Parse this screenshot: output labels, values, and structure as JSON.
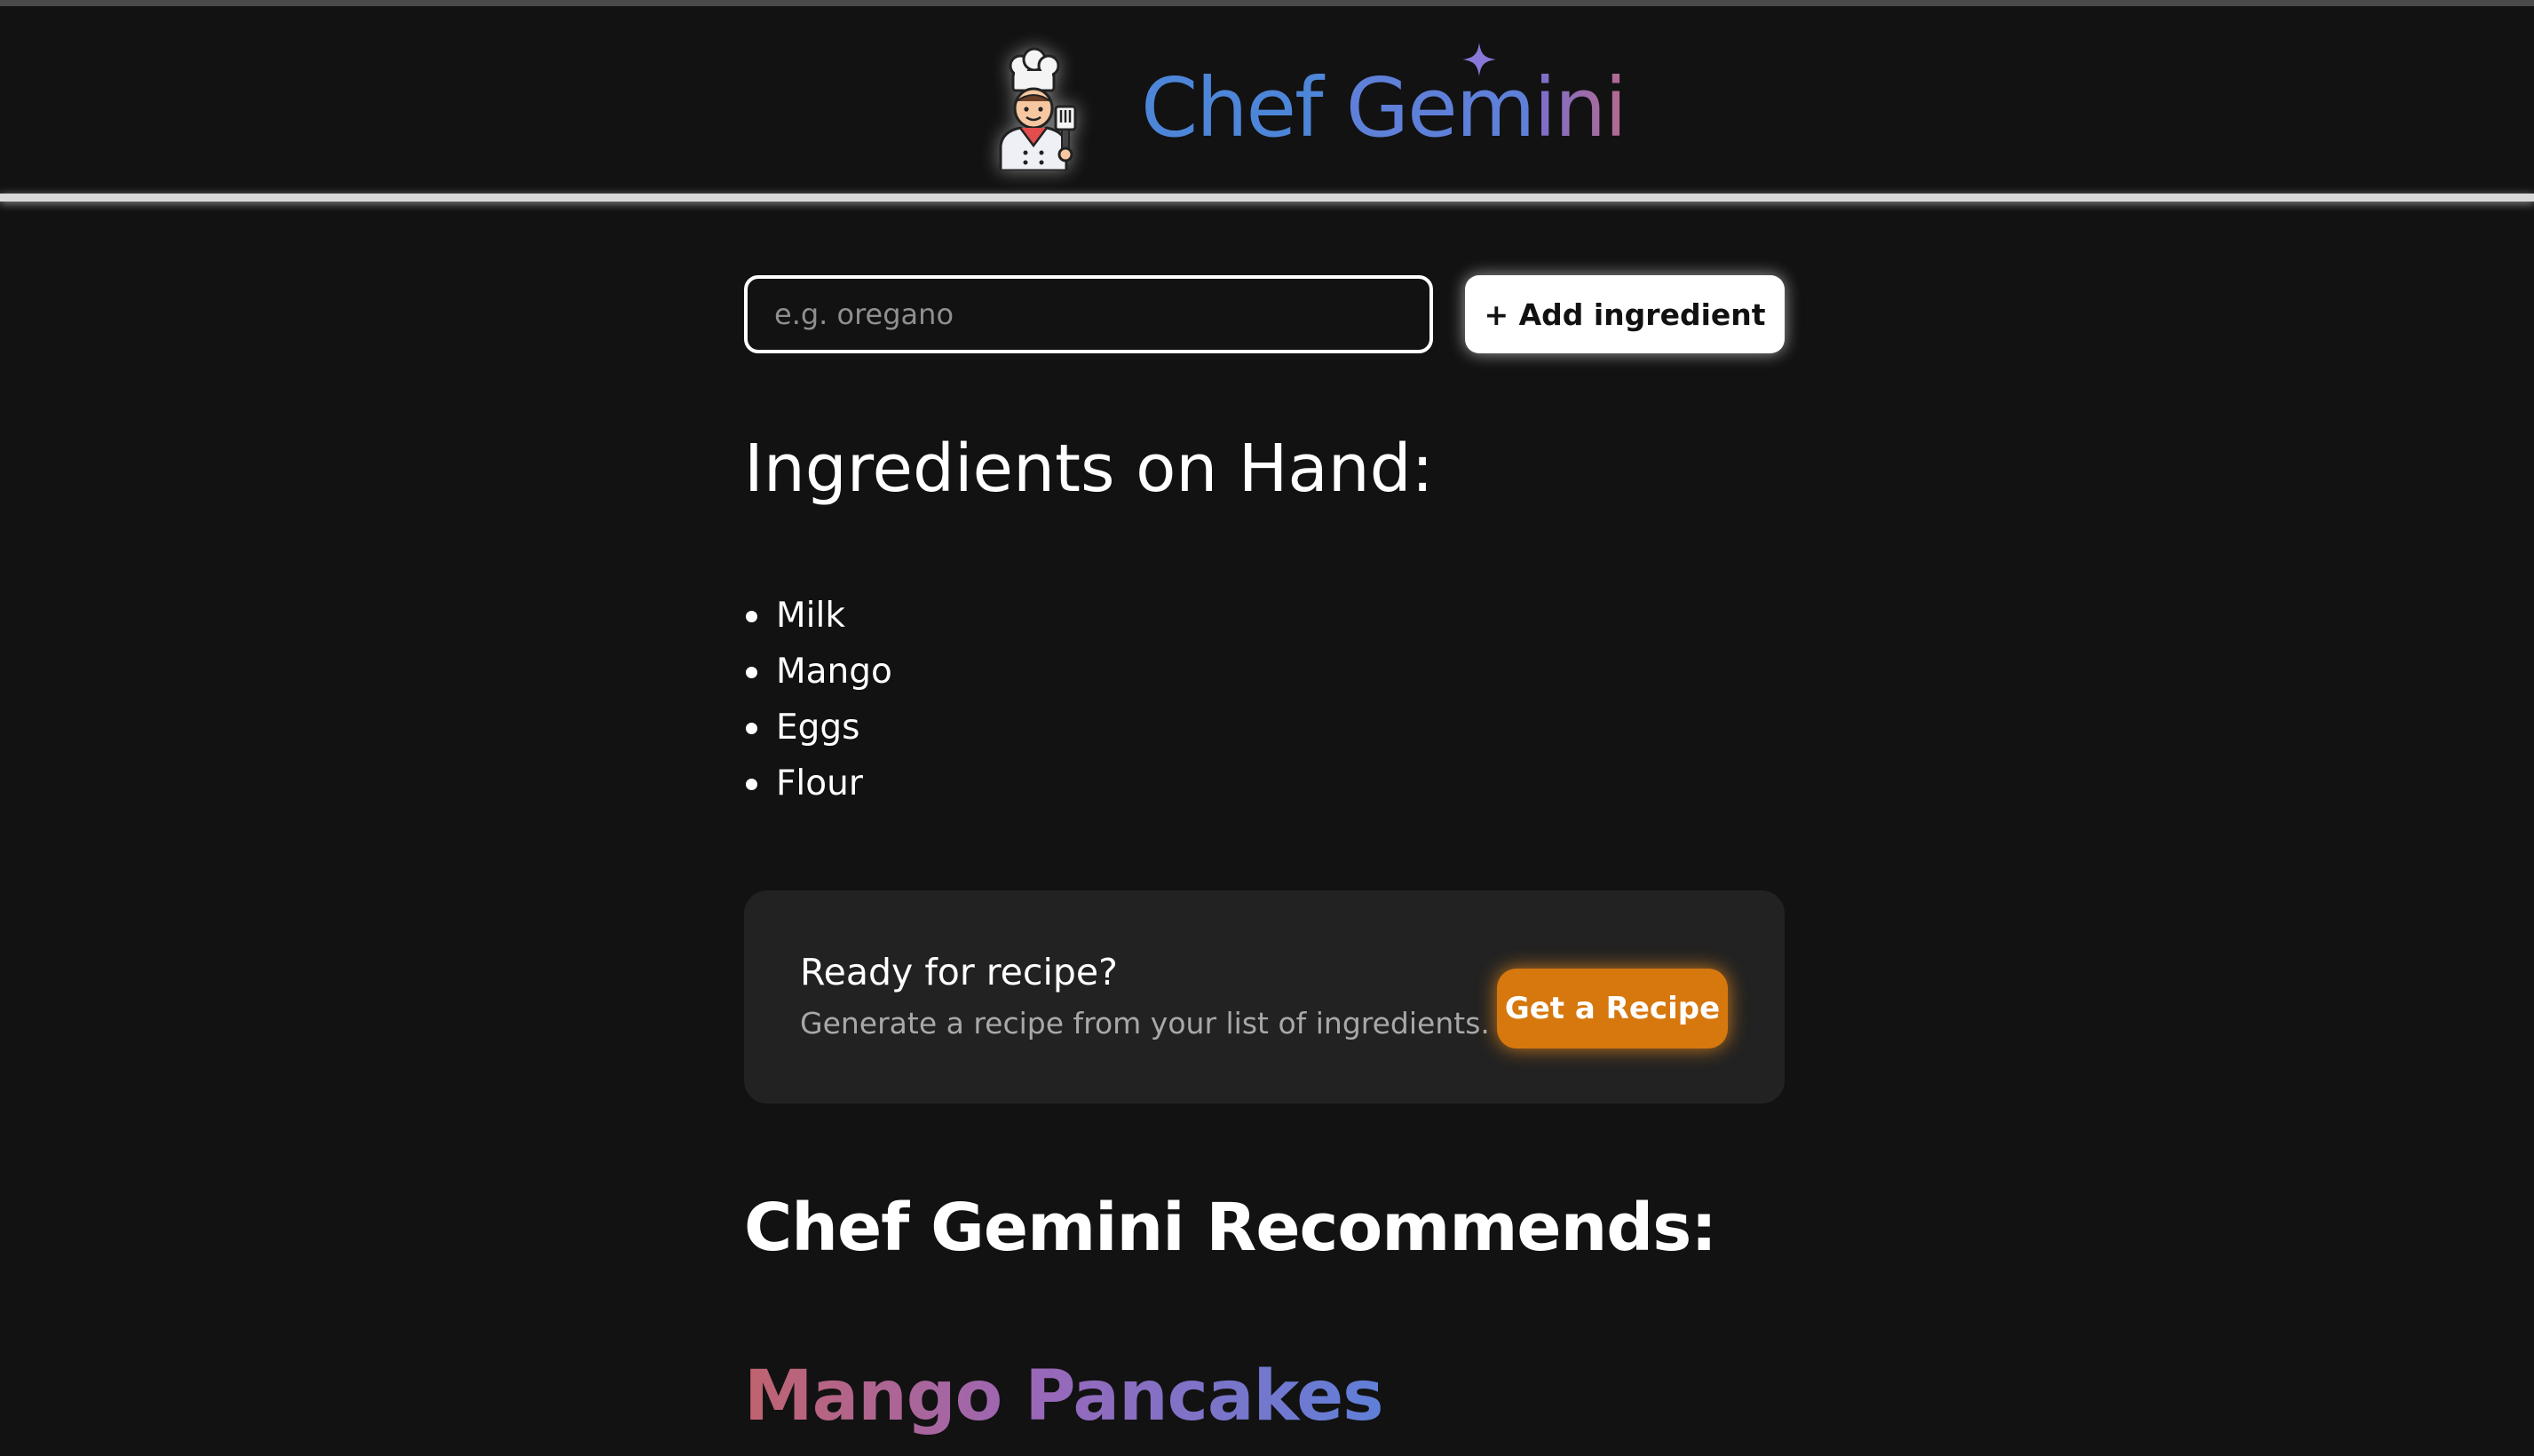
{
  "header": {
    "brand_part_1": "Chef",
    "brand_part_2": "Gem",
    "brand_part_3": "ini",
    "logo_icon": "chef-icon"
  },
  "ingredient_form": {
    "placeholder": "e.g. oregano",
    "value": "",
    "add_label": "+ Add ingredient"
  },
  "ingredients": {
    "title": "Ingredients on Hand:",
    "items": [
      "Milk",
      "Mango",
      "Eggs",
      "Flour"
    ]
  },
  "recipe_card": {
    "title": "Ready for recipe?",
    "subtitle": "Generate a recipe from your list of ingredients.",
    "button_label": "Get a Recipe"
  },
  "recommendation": {
    "title": "Chef Gemini Recommends:",
    "dish": "Mango Pancakes"
  },
  "colors": {
    "background": "#121212",
    "card": "#222222",
    "accent_orange": "#d6780e",
    "brand_blue": "#4d86d8",
    "brand_purple": "#7a6fd0",
    "brand_pink": "#b56a8e"
  }
}
